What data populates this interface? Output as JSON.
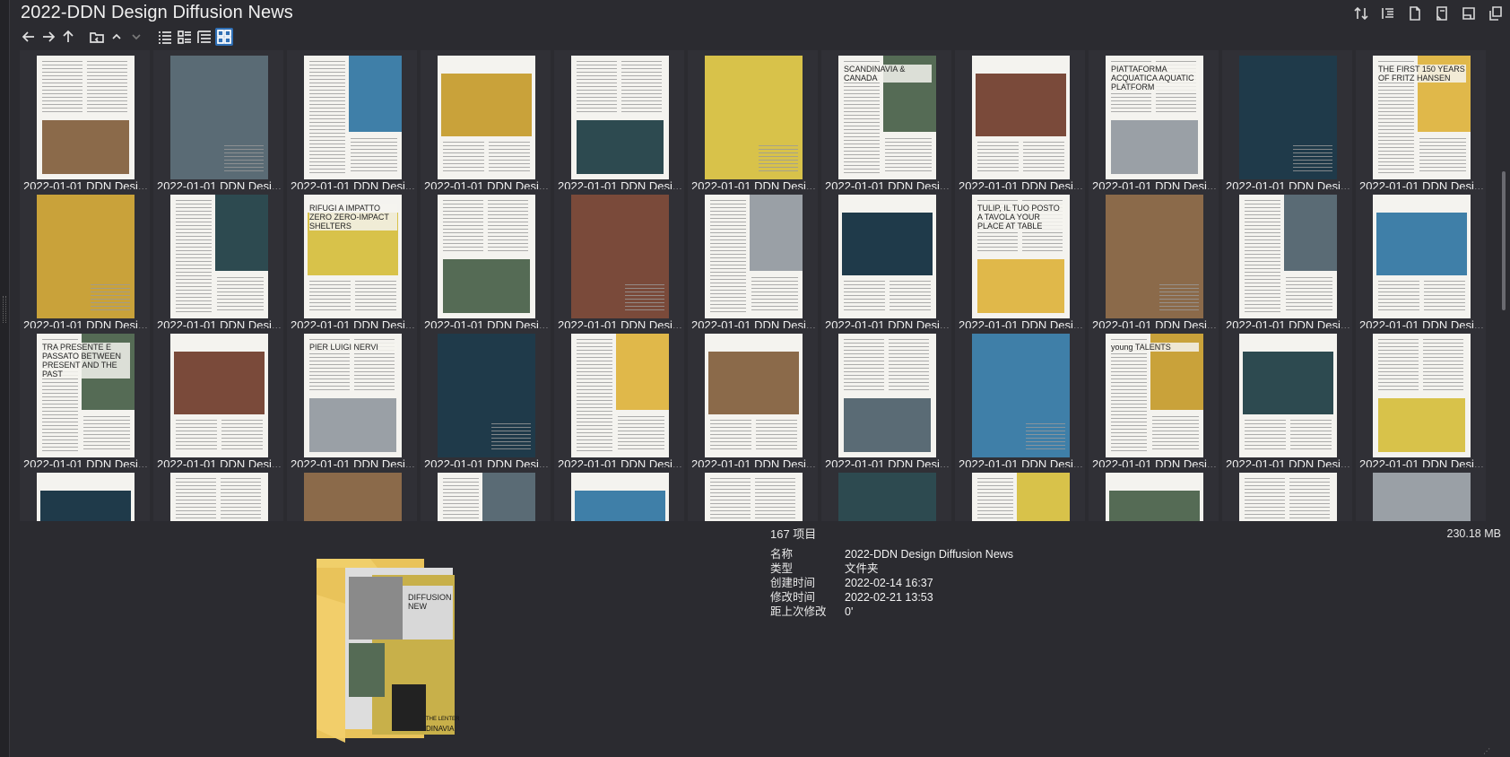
{
  "window": {
    "title": "2022-DDN Design Diffusion News"
  },
  "toolbar": {
    "buttons": [
      "back-icon",
      "forward-icon",
      "up-icon",
      "folder-open-icon",
      "chevron-up-icon",
      "chevron-down-icon"
    ],
    "views": [
      "list-view-icon",
      "detail-view-icon",
      "tree-view-icon",
      "thumbnail-view-icon"
    ],
    "active_view": "thumbnail-view-icon"
  },
  "top_icons": [
    "sort-icon",
    "outline-icon",
    "page-icon",
    "page-corner-icon",
    "panel-icon",
    "copy-icon"
  ],
  "grid": {
    "item_caption": "2022-01-01 DDN Desi...",
    "visible_full_rows": 3,
    "columns": 11,
    "partial_row": true,
    "thumb_titles": {
      "r0c6": "SCANDINAVIA & CANADA",
      "r0c8": "PIATTAFORMA ACQUATICA AQUATIC PLATFORM",
      "r0c10": "THE FIRST 150 YEARS OF FRITZ HANSEN",
      "r1c2": "RIFUGI A IMPATTO ZERO ZERO-IMPACT SHELTERS",
      "r1c7": "TULIP, IL TUO POSTO A TAVOLA YOUR PLACE AT TABLE",
      "r2c0": "TRA PRESENTE E PASSATO BETWEEN PRESENT AND THE PAST",
      "r2c2": "PIER LUIGI NERVI",
      "r2c8": "young TALENTS"
    }
  },
  "details": {
    "count": "167 项目",
    "size": "230.18 MB",
    "rows": [
      {
        "label": "名称",
        "value": "2022-DDN Design Diffusion News"
      },
      {
        "label": "类型",
        "value": "文件夹"
      },
      {
        "label": "创建时间",
        "value": "2022-02-14  16:37"
      },
      {
        "label": "修改时间",
        "value": "2022-02-21  13:53"
      },
      {
        "label": "距上次修改",
        "value": "0'"
      }
    ],
    "folder_preview_text": [
      "DIFFUSION",
      "NEW",
      "THE LENTER",
      "DINAVIA"
    ]
  }
}
